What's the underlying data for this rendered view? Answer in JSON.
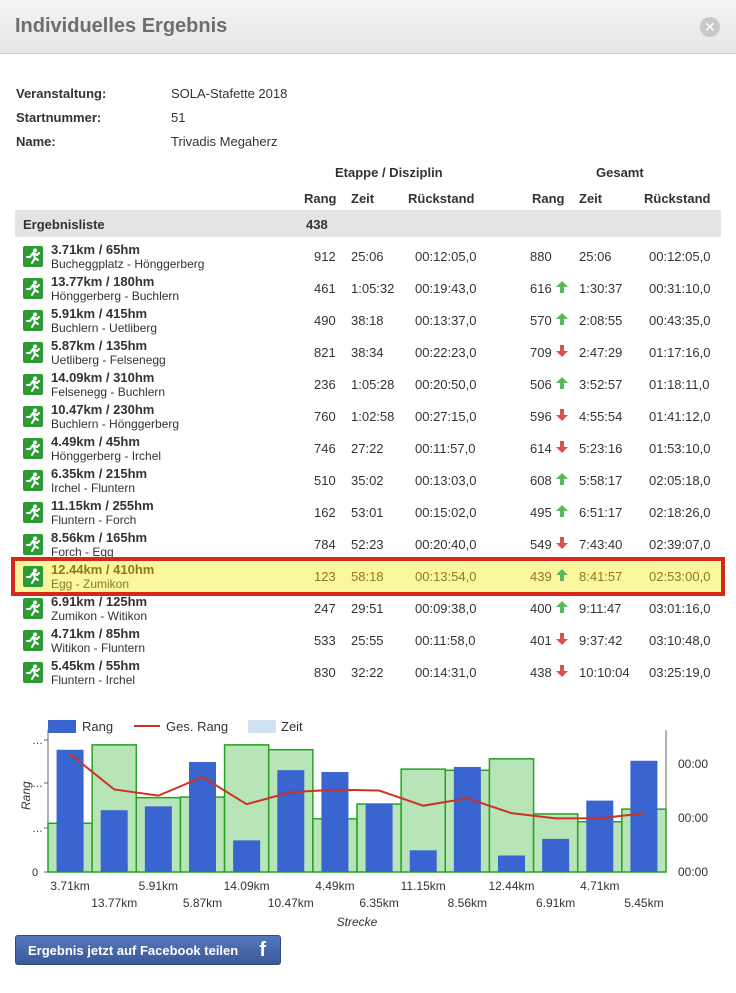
{
  "dialog": {
    "title": "Individuelles Ergebnis"
  },
  "info": {
    "event_label": "Veranstaltung:",
    "event_value": "SOLA-Stafette 2018",
    "startnr_label": "Startnummer:",
    "startnr_value": "51",
    "name_label": "Name:",
    "name_value": "Trivadis Megaherz"
  },
  "headers": {
    "group_etappe": "Etappe / Disziplin",
    "group_gesamt": "Gesamt",
    "rang": "Rang",
    "zeit": "Zeit",
    "rueckstand": "Rückstand"
  },
  "liste": {
    "label": "Ergebnisliste",
    "count": "438"
  },
  "rows": [
    {
      "title": "3.71km / 65hm",
      "sub": "Bucheggplatz - Hönggerberg",
      "rang": "912",
      "zeit": "25:06",
      "rueck": "00:12:05,0",
      "grang": "880",
      "trend": "none",
      "gzeit": "25:06",
      "grueck": "00:12:05,0"
    },
    {
      "title": "13.77km / 180hm",
      "sub": "Hönggerberg - Buchlern",
      "rang": "461",
      "zeit": "1:05:32",
      "rueck": "00:19:43,0",
      "grang": "616",
      "trend": "up",
      "gzeit": "1:30:37",
      "grueck": "00:31:10,0"
    },
    {
      "title": "5.91km / 415hm",
      "sub": "Buchlern - Uetliberg",
      "rang": "490",
      "zeit": "38:18",
      "rueck": "00:13:37,0",
      "grang": "570",
      "trend": "up",
      "gzeit": "2:08:55",
      "grueck": "00:43:35,0"
    },
    {
      "title": "5.87km / 135hm",
      "sub": "Uetliberg - Felsenegg",
      "rang": "821",
      "zeit": "38:34",
      "rueck": "00:22:23,0",
      "grang": "709",
      "trend": "down",
      "gzeit": "2:47:29",
      "grueck": "01:17:16,0"
    },
    {
      "title": "14.09km / 310hm",
      "sub": "Felsenegg - Buchlern",
      "rang": "236",
      "zeit": "1:05:28",
      "rueck": "00:20:50,0",
      "grang": "506",
      "trend": "up",
      "gzeit": "3:52:57",
      "grueck": "01:18:11,0"
    },
    {
      "title": "10.47km / 230hm",
      "sub": "Buchlern - Hönggerberg",
      "rang": "760",
      "zeit": "1:02:58",
      "rueck": "00:27:15,0",
      "grang": "596",
      "trend": "down",
      "gzeit": "4:55:54",
      "grueck": "01:41:12,0"
    },
    {
      "title": "4.49km / 45hm",
      "sub": "Hönggerberg - Irchel",
      "rang": "746",
      "zeit": "27:22",
      "rueck": "00:11:57,0",
      "grang": "614",
      "trend": "down",
      "gzeit": "5:23:16",
      "grueck": "01:53:10,0"
    },
    {
      "title": "6.35km / 215hm",
      "sub": "Irchel - Fluntern",
      "rang": "510",
      "zeit": "35:02",
      "rueck": "00:13:03,0",
      "grang": "608",
      "trend": "up",
      "gzeit": "5:58:17",
      "grueck": "02:05:18,0"
    },
    {
      "title": "11.15km / 255hm",
      "sub": "Fluntern - Forch",
      "rang": "162",
      "zeit": "53:01",
      "rueck": "00:15:02,0",
      "grang": "495",
      "trend": "up",
      "gzeit": "6:51:17",
      "grueck": "02:18:26,0"
    },
    {
      "title": "8.56km / 165hm",
      "sub": "Forch - Egg",
      "rang": "784",
      "zeit": "52:23",
      "rueck": "00:20:40,0",
      "grang": "549",
      "trend": "down",
      "gzeit": "7:43:40",
      "grueck": "02:39:07,0"
    },
    {
      "title": "12.44km / 410hm",
      "sub": "Egg - Zumikon",
      "rang": "123",
      "zeit": "58:18",
      "rueck": "00:13:54,0",
      "grang": "439",
      "trend": "up",
      "gzeit": "8:41:57",
      "grueck": "02:53:00,0"
    },
    {
      "title": "6.91km / 125hm",
      "sub": "Zumikon - Witikon",
      "rang": "247",
      "zeit": "29:51",
      "rueck": "00:09:38,0",
      "grang": "400",
      "trend": "up",
      "gzeit": "9:11:47",
      "grueck": "03:01:16,0"
    },
    {
      "title": "4.71km / 85hm",
      "sub": "Witikon - Fluntern",
      "rang": "533",
      "zeit": "25:55",
      "rueck": "00:11:58,0",
      "grang": "401",
      "trend": "down",
      "gzeit": "9:37:42",
      "grueck": "03:10:48,0"
    },
    {
      "title": "5.45km / 55hm",
      "sub": "Fluntern - Irchel",
      "rang": "830",
      "zeit": "32:22",
      "rueck": "00:14:31,0",
      "grang": "438",
      "trend": "down",
      "gzeit": "10:10:04",
      "grueck": "03:25:19,0"
    }
  ],
  "highlight_row": 10,
  "colors": {
    "bar": "#3a64d0",
    "line": "#cc3322",
    "area_fill": "#b8e5b8",
    "area_stroke": "#26a026",
    "up": "#5cb85c",
    "down": "#d9534f",
    "highlight": "#fbf79f",
    "highlight_border": "#d6271b"
  },
  "chart_data": {
    "type": "bar",
    "legend": [
      "Rang",
      "Ges. Rang",
      "Zeit"
    ],
    "legend_position": "top-left",
    "xlabel": "Strecke",
    "ylabel": "Rang",
    "y_left_ticks": [
      "0",
      "…",
      "…",
      "…"
    ],
    "y_right_ticks": [
      "00:00",
      "00:00",
      "00:00"
    ],
    "categories": [
      "3.71km",
      "13.77km",
      "5.91km",
      "5.87km",
      "14.09km",
      "10.47km",
      "4.49km",
      "6.35km",
      "11.15km",
      "8.56km",
      "12.44km",
      "6.91km",
      "4.71km",
      "5.45km"
    ],
    "series": [
      {
        "name": "Rang",
        "type": "bar",
        "values": [
          912,
          461,
          490,
          821,
          236,
          760,
          746,
          510,
          162,
          784,
          123,
          247,
          533,
          830
        ]
      },
      {
        "name": "Ges. Rang",
        "type": "line",
        "values": [
          880,
          616,
          570,
          709,
          506,
          596,
          614,
          608,
          495,
          549,
          439,
          400,
          401,
          438
        ]
      },
      {
        "name": "Zeit",
        "type": "step-area",
        "unit": "minutes",
        "values": [
          25.1,
          65.5,
          38.3,
          38.6,
          65.5,
          63.0,
          27.4,
          35.0,
          53.0,
          52.4,
          58.3,
          29.9,
          25.9,
          32.4
        ]
      }
    ],
    "ylim": [
      0,
      1000
    ]
  },
  "facebook": {
    "label": "Ergebnis jetzt auf Facebook teilen",
    "icon": "f"
  }
}
